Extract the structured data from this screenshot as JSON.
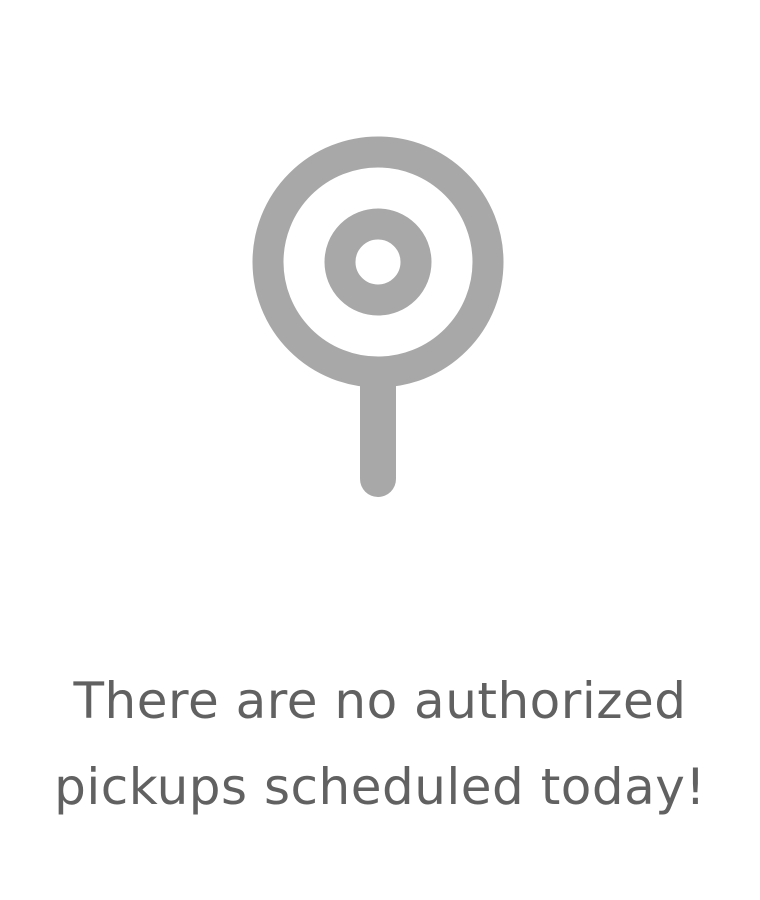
{
  "empty_state": {
    "icon": "location-pin-icon",
    "message": "There are no authorized pickups scheduled today!"
  },
  "colors": {
    "background": "#ffffff",
    "icon": "#a8a8a8",
    "text": "#616161"
  }
}
